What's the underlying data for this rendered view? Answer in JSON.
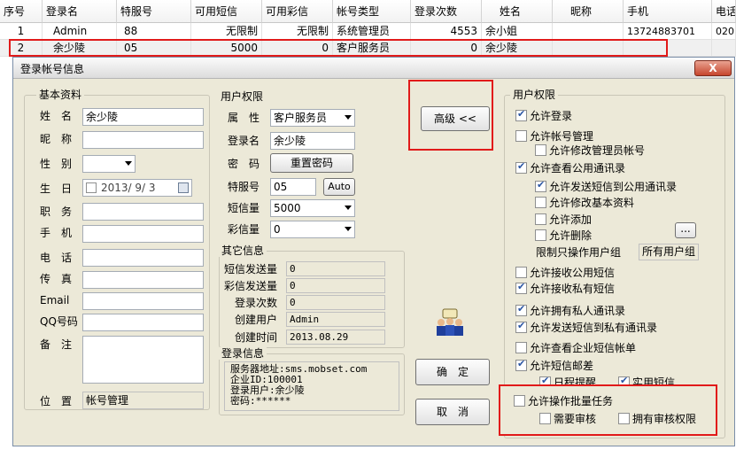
{
  "grid": {
    "columns": [
      "序号",
      "登录名",
      "特服号",
      "可用短信",
      "可用彩信",
      "帐号类型",
      "登录次数",
      "姓名",
      "昵称",
      "手机",
      "电话"
    ],
    "rows": [
      [
        "1",
        "Admin",
        "88",
        "无限制",
        "无限制",
        "系统管理员",
        "4553",
        "余小姐",
        "",
        "13724883701",
        "020"
      ],
      [
        "2",
        "余少陵",
        "05",
        "5000",
        "0",
        "客户服务员",
        "0",
        "余少陵",
        "",
        "",
        ""
      ]
    ]
  },
  "dialog": {
    "title": "登录帐号信息",
    "close_label": "X",
    "basic": {
      "legend": "基本资料",
      "name_label": "姓　名",
      "name_value": "余少陵",
      "nickname_label": "昵　称",
      "nickname_value": "",
      "gender_label": "性　别",
      "gender_value": "",
      "birthday_label": "生　日",
      "birthday_value": "2013/ 9/ 3",
      "position_label": "职　务",
      "position_value": "",
      "mobile_label": "手　机",
      "mobile_value": "",
      "phone_label": "电　话",
      "phone_value": "",
      "fax_label": "传　真",
      "fax_value": "",
      "email_label": "Email",
      "email_value": "",
      "qq_label": "QQ号码",
      "qq_value": "",
      "remark_label": "备　注",
      "remark_value": "",
      "location_label": "位　置",
      "location_value": "帐号管理"
    },
    "rights": {
      "legend": "用户权限",
      "attr_label": "属　性",
      "attr_value": "客户服务员",
      "login_label": "登录名",
      "login_value": "余少陵",
      "password_label": "密　码",
      "reset_password_label": "重置密码",
      "special_label": "特服号",
      "special_value": "05",
      "auto_label": "Auto",
      "sms_label": "短信量",
      "sms_value": "5000",
      "mms_label": "彩信量",
      "mms_value": "0"
    },
    "other": {
      "legend": "其它信息",
      "sms_sent_label": "短信发送量",
      "sms_sent_value": "0",
      "mms_sent_label": "彩信发送量",
      "mms_sent_value": "0",
      "login_count_label": "登录次数",
      "login_count_value": "0",
      "creator_label": "创建用户",
      "creator_value": "Admin",
      "created_label": "创建时间",
      "created_value": "2013.08.29"
    },
    "login_info": {
      "legend": "登录信息",
      "lines": [
        "服务器地址:sms.mobset.com",
        "企业ID:100001",
        "登录用户:余少陵",
        "密码:******"
      ]
    },
    "advanced_label": "高级 <<",
    "ok_label": "确　定",
    "cancel_label": "取　消",
    "perms": {
      "legend": "用户权限",
      "items": [
        {
          "label": "允许登录",
          "checked": true
        },
        {
          "label": "允许帐号管理",
          "checked": false
        },
        {
          "label": "允许修改管理员帐号",
          "checked": false
        },
        {
          "label": "允许查看公用通讯录",
          "checked": true
        },
        {
          "label": "允许发送短信到公用通讯录",
          "checked": true
        },
        {
          "label": "允许修改基本资料",
          "checked": false
        },
        {
          "label": "允许添加",
          "checked": false
        },
        {
          "label": "允许删除",
          "checked": false
        },
        {
          "label": "允许接收公用短信",
          "checked": false
        },
        {
          "label": "允许接收私有短信",
          "checked": true
        },
        {
          "label": "允许拥有私人通讯录",
          "checked": true
        },
        {
          "label": "允许发送短信到私有通讯录",
          "checked": true
        },
        {
          "label": "允许查看企业短信帐单",
          "checked": false
        },
        {
          "label": "允许短信邮差",
          "checked": true
        },
        {
          "label": "日程提醒",
          "checked": true
        },
        {
          "label": "实用短信",
          "checked": true
        },
        {
          "label": "允许操作批量任务",
          "checked": false
        },
        {
          "label": "需要审核",
          "checked": false
        },
        {
          "label": "拥有审核权限",
          "checked": false
        }
      ],
      "group_limit_label": "限制只操作用户组",
      "group_limit_value": "所有用户组",
      "more_label": "..."
    }
  }
}
